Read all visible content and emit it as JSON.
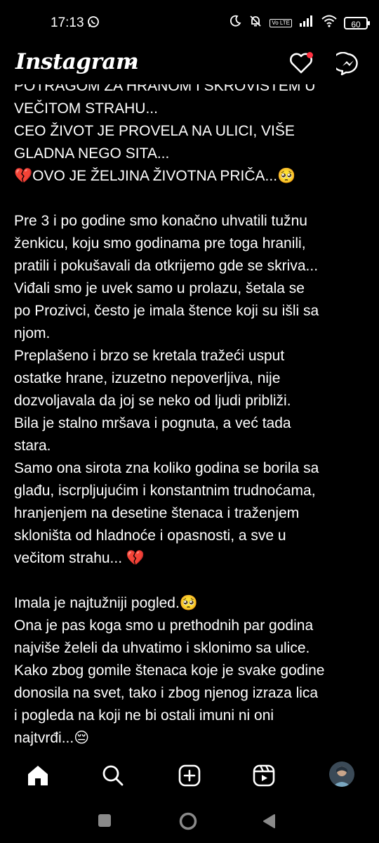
{
  "status_bar": {
    "time": "17:13",
    "battery": "60",
    "volte": "Vo LTE",
    "icons": [
      "whatsapp-icon",
      "moon-icon",
      "bell-off-icon",
      "volte-icon",
      "signal-icon",
      "wifi-icon",
      "battery-icon"
    ]
  },
  "header": {
    "logo": "Instagram",
    "icons": [
      "chevron-down-icon",
      "heart-icon",
      "messenger-icon"
    ],
    "notification_color": "#ff3040"
  },
  "post": {
    "lines": [
      "POTRAGOM ZA HRANOM I SKROVIŠTEM U",
      "VEČITOM STRAHU...",
      "CEO ŽIVOT JE PROVELA NA ULICI, VIŠE",
      "GLADNA NEGO SITA...",
      "💔OVO JE ŽELJINA ŽIVOTNA PRIČA...🥺",
      "",
      "Pre 3 i po godine smo konačno uhvatili tužnu",
      "ženkicu, koju smo godinama pre toga hranili,",
      "pratili i pokušavali da otkrijemo gde se skriva...",
      "Viđali smo je uvek samo u prolazu, šetala se",
      "po Prozivci, često je imala štence koji su išli sa",
      "njom.",
      "Preplašeno i brzo se kretala tražeći usput",
      "ostatke hrane, izuzetno nepoverljiva, nije",
      "dozvoljavala da joj se neko od ljudi približi.",
      "Bila je stalno mršava i pognuta, a već tada",
      "stara.",
      "Samo ona sirota zna koliko godina se borila sa",
      "glađu, iscrpljujućim i konstantnim trudnoćama,",
      "hranjenjem na desetine štenaca i traženjem",
      "skloništa od hladnoće i opasnosti, a sve u",
      "večitom strahu... 💔",
      "",
      "Imala je najtužniji pogled.🥺",
      "Ona je pas koga smo u prethodnih par godina",
      "najviše želeli da uhvatimo i sklonimo sa ulice.",
      "Kako zbog gomile štenaca koje je svake godine",
      "donosila na svet, tako i zbog njenog izraza lica",
      "i pogleda na koji ne bi ostali imuni ni oni",
      "najtvrđi...😔"
    ]
  },
  "bottom_nav": {
    "items": [
      "home-icon",
      "search-icon",
      "create-icon",
      "reels-icon",
      "profile-avatar"
    ]
  },
  "system_nav": {
    "items": [
      "recents-button",
      "home-button",
      "back-button"
    ]
  }
}
